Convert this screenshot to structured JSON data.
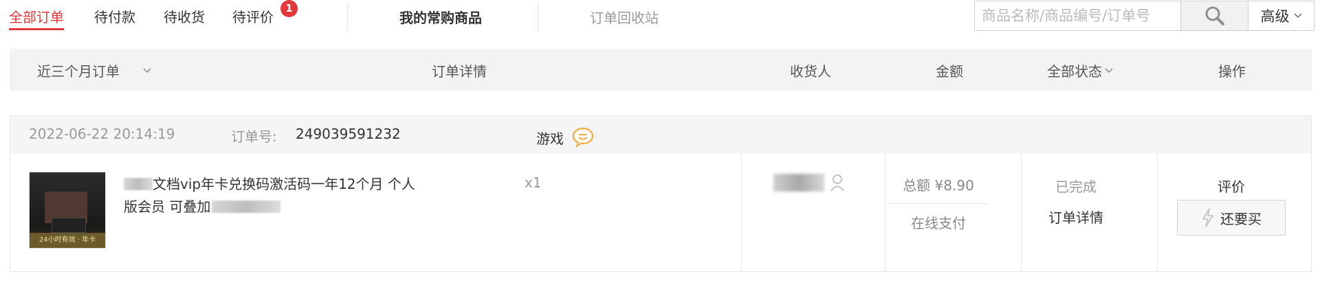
{
  "tabs": {
    "all_orders": "全部订单",
    "pending_payment": "待付款",
    "pending_receipt": "待收货",
    "pending_review": "待评价",
    "pending_review_badge": "1",
    "frequent_items": "我的常购商品",
    "recycle_bin": "订单回收站"
  },
  "search": {
    "placeholder": "商品名称/商品编号/订单号",
    "value": "",
    "advanced_label": "高级"
  },
  "header": {
    "time_filter": "近三个月订单",
    "details": "订单详情",
    "receiver": "收货人",
    "amount": "金额",
    "status_filter": "全部状态",
    "actions": "操作"
  },
  "order": {
    "datetime": "2022-06-22 20:14:19",
    "order_no_label": "订单号:",
    "order_no": "249039591232",
    "shop_name": "游戏",
    "product_name_part1": "文档vip年卡兑换码激活码一年12个月 个人版会员 可叠加",
    "quantity": "x1",
    "total_label": "总额 ¥8.90",
    "payment_method": "在线支付",
    "status": "已完成",
    "detail_link": "订单详情",
    "review_link": "评价",
    "rebuy_label": "还要买",
    "thumb_caption": "24小时有效 · 年卡"
  },
  "colors": {
    "accent": "#e4393c",
    "header_bg": "#f3f3f3",
    "order_head_bg": "#f5f5f5",
    "chat_icon": "#f0b24a"
  }
}
